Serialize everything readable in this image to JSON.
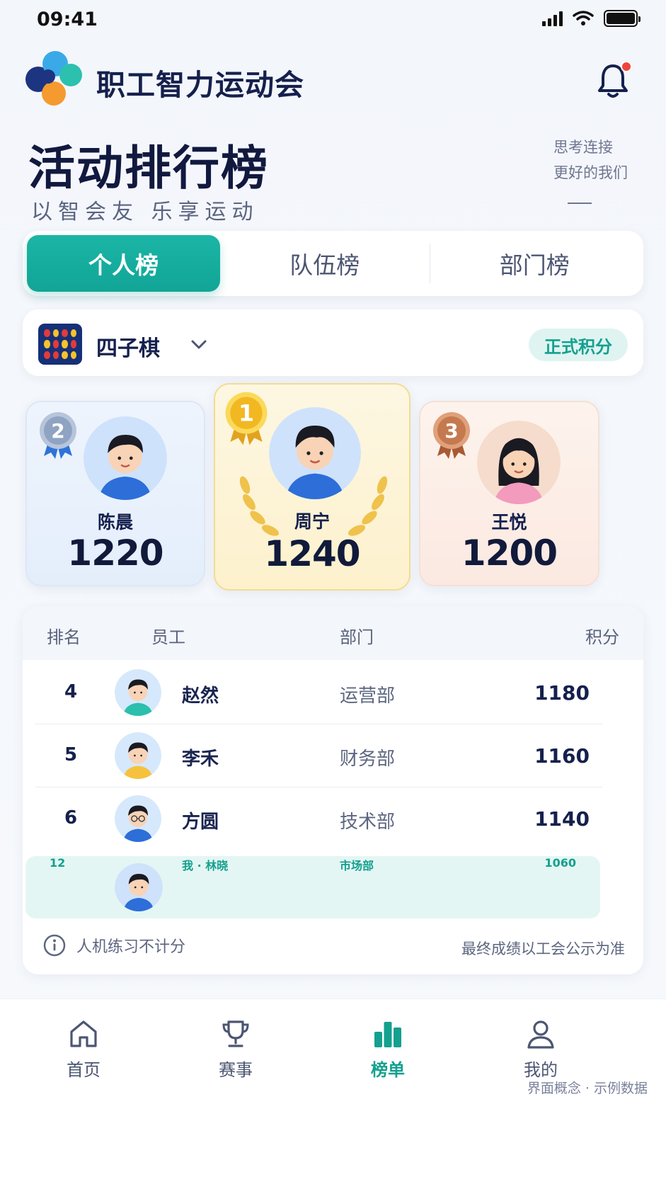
{
  "status": {
    "time": "09:41"
  },
  "header": {
    "app_title": "职工智力运动会"
  },
  "page": {
    "title": "活动排行榜",
    "subtitle": "以智会友 乐享运动",
    "slogan_line1": "思考连接",
    "slogan_line2": "更好的我们"
  },
  "tabs": [
    {
      "label": "个人榜",
      "active": true
    },
    {
      "label": "队伍榜",
      "active": false
    },
    {
      "label": "部门榜",
      "active": false
    }
  ],
  "game": {
    "name": "四子棋",
    "badge": "正式积分"
  },
  "podium": [
    {
      "rank": "1",
      "name": "周宁",
      "score": "1240"
    },
    {
      "rank": "2",
      "name": "陈晨",
      "score": "1220"
    },
    {
      "rank": "3",
      "name": "王悦",
      "score": "1200"
    }
  ],
  "table": {
    "headers": {
      "rank": "排名",
      "employee": "员工",
      "department": "部门",
      "score": "积分"
    },
    "rows": [
      {
        "rank": "4",
        "name": "赵然",
        "dept": "运营部",
        "score": "1180"
      },
      {
        "rank": "5",
        "name": "李禾",
        "dept": "财务部",
        "score": "1160"
      },
      {
        "rank": "6",
        "name": "方圆",
        "dept": "技术部",
        "score": "1140"
      }
    ],
    "me": {
      "rank": "12",
      "name": "我 · 林晓",
      "dept": "市场部",
      "score": "1060"
    },
    "note_left": "人机练习不计分",
    "note_right": "最终成绩以工会公示为准"
  },
  "nav": [
    {
      "label": "首页"
    },
    {
      "label": "赛事"
    },
    {
      "label": "榜单",
      "active": true
    },
    {
      "label": "我的"
    }
  ],
  "watermark": "界面概念 · 示例数据",
  "colors": {
    "accent": "#14a08f",
    "gold": "#f3c33a",
    "silver": "#9fb2cf",
    "bronze": "#c47a4e",
    "navy": "#15204d"
  }
}
